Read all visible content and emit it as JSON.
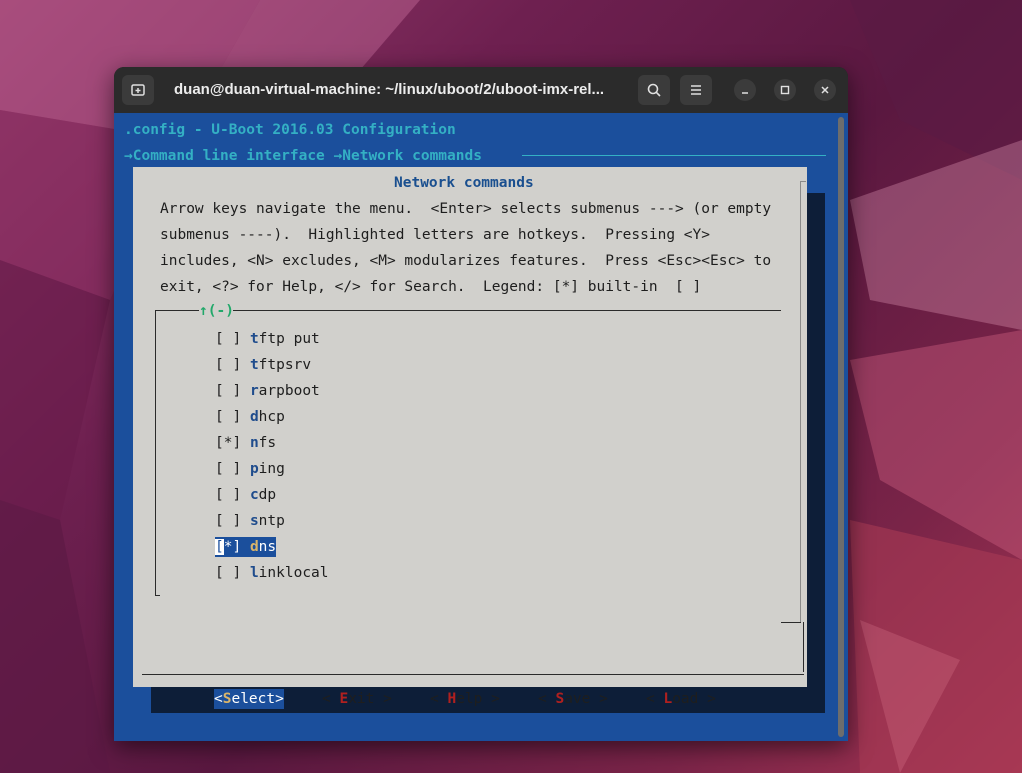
{
  "window": {
    "title": "duan@duan-virtual-machine: ~/linux/uboot/2/uboot-imx-rel..."
  },
  "terminal": {
    "header_line": ".config - U-Boot 2016.03 Configuration",
    "breadcrumb": [
      "Command line interface",
      "Network commands"
    ],
    "dialog": {
      "title": "Network commands",
      "help_lines": [
        "Arrow keys navigate the menu.  <Enter> selects submenus ---> (or empty",
        "submenus ----).  Highlighted letters are hotkeys.  Pressing <Y>",
        "includes, <N> excludes, <M> modularizes features.  Press <Esc><Esc> to",
        "exit, <?> for Help, </> for Search.  Legend: [*] built-in  [ ]"
      ],
      "scroll_indicator": "↑(-)",
      "items": [
        {
          "mark": "[ ]",
          "hotkey": "t",
          "rest": "ftp put"
        },
        {
          "mark": "[ ]",
          "hotkey": "t",
          "rest": "ftpsrv"
        },
        {
          "mark": "[ ]",
          "hotkey": "r",
          "rest": "arpboot"
        },
        {
          "mark": "[ ]",
          "hotkey": "d",
          "rest": "hcp"
        },
        {
          "mark": "[*]",
          "hotkey": "n",
          "rest": "fs"
        },
        {
          "mark": "[ ]",
          "hotkey": "p",
          "rest": "ing"
        },
        {
          "mark": "[ ]",
          "hotkey": "c",
          "rest": "dp"
        },
        {
          "mark": "[ ]",
          "hotkey": "s",
          "rest": "ntp"
        },
        {
          "mark": "[*]",
          "hotkey": "d",
          "rest": "ns"
        },
        {
          "mark": "[ ]",
          "hotkey": "l",
          "rest": "inklocal"
        }
      ],
      "selected_index": 8,
      "buttons": [
        {
          "pre": "<",
          "hotkey": "S",
          "post": "elect>"
        },
        {
          "pre": "< ",
          "hotkey": "E",
          "post": "xit >"
        },
        {
          "pre": "< ",
          "hotkey": "H",
          "post": "elp >"
        },
        {
          "pre": "< ",
          "hotkey": "S",
          "post": "ave >"
        },
        {
          "pre": "< ",
          "hotkey": "L",
          "post": "oad >"
        }
      ]
    }
  }
}
